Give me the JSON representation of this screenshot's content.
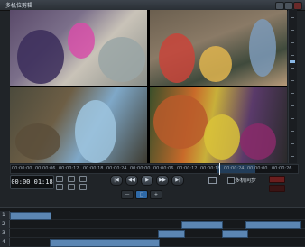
{
  "window": {
    "title": "多机位剪辑"
  },
  "timecode": {
    "current": "00:00:01:18"
  },
  "timeline": {
    "labels": [
      "00:00:00",
      "00:00:06",
      "00:00:12",
      "00:00:18",
      "00:00:24",
      "00:00:00",
      "00:00:06",
      "00:00:12",
      "00:00:18",
      "00:00:24",
      "00:00:00",
      "00:00:26"
    ]
  },
  "controls": {
    "sync_label": "多机同步",
    "transport": [
      "|◀",
      "◀◀",
      "▶",
      "▶▶",
      "▶|"
    ],
    "zoom": [
      "—",
      "□",
      "+"
    ]
  },
  "tracks": [
    {
      "num": "1"
    },
    {
      "num": "2"
    },
    {
      "num": "3"
    },
    {
      "num": "4"
    }
  ],
  "colors": {
    "accent": "#2f6aa8",
    "clip": "#5b86b3",
    "record": "#6b1e1e"
  }
}
